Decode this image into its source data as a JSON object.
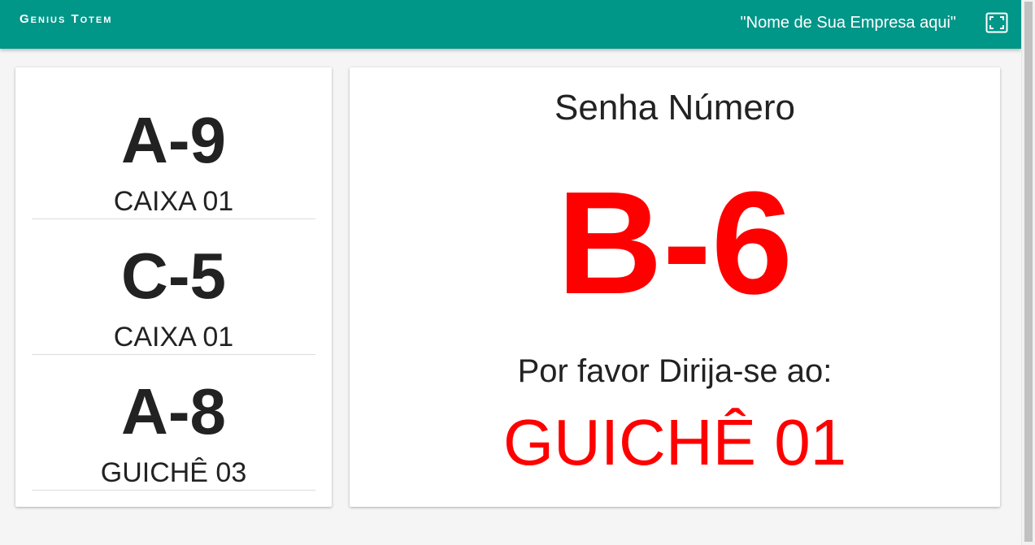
{
  "header": {
    "brand": "Genius Totem",
    "company": "\"Nome de Sua Empresa aqui\"",
    "fullscreen_icon": "fullscreen-icon",
    "background_color": "#009688"
  },
  "history": [
    {
      "code": "A-9",
      "desk": "CAIXA 01"
    },
    {
      "code": "C-5",
      "desk": "CAIXA 01"
    },
    {
      "code": "A-8",
      "desk": "GUICHÊ 03"
    }
  ],
  "current": {
    "title": "Senha Número",
    "code": "B-6",
    "prompt": "Por favor Dirija-se ao:",
    "desk": "GUICHÊ 01",
    "highlight_color": "#ff0000"
  }
}
